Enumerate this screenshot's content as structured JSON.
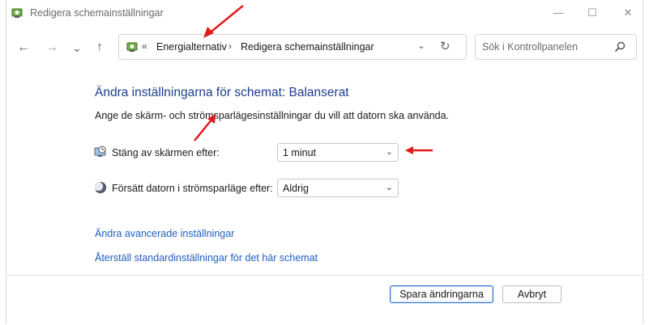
{
  "window": {
    "title": "Redigera schemainställningar",
    "controls": {
      "minimize": "—",
      "maximize": "☐",
      "close": "✕"
    }
  },
  "nav": {
    "back": "←",
    "forward": "→",
    "recent": "⌄",
    "up": "↑",
    "address": {
      "prefix": "«",
      "crumbs": [
        "Energialternativ",
        "Redigera schemainställningar"
      ],
      "separator": "›",
      "dropdown": "⌄",
      "refresh": "↻"
    },
    "search": {
      "placeholder": "Sök i Kontrollpanelen"
    }
  },
  "content": {
    "heading": "Ändra inställningarna för schemat: Balanserat",
    "description": "Ange de skärm- och strömsparlägesinställningar du vill att datorn ska använda.",
    "settings": [
      {
        "label": "Stäng av skärmen efter:",
        "value": "1 minut",
        "icon": "display-clock-icon"
      },
      {
        "label": "Försätt datorn i strömsparläge efter:",
        "value": "Aldrig",
        "icon": "moon-sleep-icon"
      }
    ],
    "dropdown_chevron": "⌄",
    "links": [
      "Ändra avancerade inställningar",
      "Återställ standardinställningar för det här schemat"
    ]
  },
  "footer": {
    "save_label": "Spara ändringarna",
    "cancel_label": "Avbryt"
  },
  "colors": {
    "heading": "#1e3d8f",
    "link": "#1f5fbf",
    "annotation_arrow": "#e01b1b",
    "primary_border": "#2a6fd1"
  }
}
